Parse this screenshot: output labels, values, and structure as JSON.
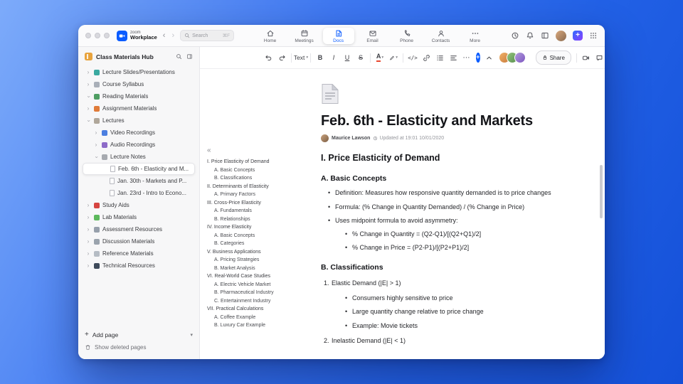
{
  "glyphs": {
    "back": "‹",
    "forward": "›",
    "chevron_down": "▾",
    "more": "⋯",
    "collapse": "«",
    "plus": "+"
  },
  "titlebar": {
    "logo": {
      "top": "zoom",
      "bottom": "Workplace"
    },
    "search": {
      "placeholder": "Search",
      "shortcut": "⌘F"
    },
    "tabs": [
      {
        "label": "Home",
        "active": false
      },
      {
        "label": "Meetings",
        "active": false
      },
      {
        "label": "Docs",
        "active": true
      },
      {
        "label": "Email",
        "active": false
      },
      {
        "label": "Phone",
        "active": false
      },
      {
        "label": "Contacts",
        "active": false
      },
      {
        "label": "More",
        "active": false
      }
    ]
  },
  "sidebar": {
    "title": "Class Materials Hub",
    "items": [
      {
        "label": "Lecture Slides/Presentations",
        "chevron": "right",
        "color": "#3aa9a0",
        "indent": 0
      },
      {
        "label": "Course Syllabus",
        "chevron": "right",
        "color": "#a9afb8",
        "indent": 0
      },
      {
        "label": "Reading Materials",
        "chevron": "down",
        "color": "#4f9e63",
        "indent": 0
      },
      {
        "label": "Assignment Materials",
        "chevron": "right",
        "color": "#e07b39",
        "indent": 0
      },
      {
        "label": "Lectures",
        "chevron": "down",
        "color": "#b0a79a",
        "indent": 0
      },
      {
        "label": "Video Recordings",
        "chevron": "right",
        "color": "#4c7fe0",
        "indent": 1
      },
      {
        "label": "Audio Recordings",
        "chevron": "right",
        "color": "#8d6bc8",
        "indent": 1
      },
      {
        "label": "Lecture Notes",
        "chevron": "down",
        "color": "#a7aab0",
        "indent": 1
      },
      {
        "label": "Feb. 6th - Elasticity and M...",
        "page": true,
        "indent": 2,
        "selected": true
      },
      {
        "label": "Jan. 30th - Markets and P...",
        "page": true,
        "indent": 2
      },
      {
        "label": "Jan. 23rd - Intro to Econo...",
        "page": true,
        "indent": 2
      },
      {
        "label": "Study Aids",
        "chevron": "right",
        "color": "#d64541",
        "indent": 0
      },
      {
        "label": "Lab Materials",
        "chevron": "right",
        "color": "#5cb85c",
        "indent": 0
      },
      {
        "label": "Assessment Resources",
        "chevron": "right",
        "color": "#97a0ac",
        "indent": 0
      },
      {
        "label": "Discussion Materials",
        "chevron": "right",
        "color": "#9aa3ad",
        "indent": 0
      },
      {
        "label": "Reference Materials",
        "chevron": "right",
        "color": "#b5bcc4",
        "indent": 0
      },
      {
        "label": "Technical Resources",
        "chevron": "right",
        "color": "#3e4a5a",
        "indent": 0
      }
    ],
    "add_page": "Add page",
    "show_deleted": "Show deleted pages"
  },
  "toolbar": {
    "text_style": "Text",
    "bold": "B",
    "italic": "I",
    "underline": "U",
    "strikethrough": "S",
    "text_color": "A",
    "code": "</>",
    "share": "Share",
    "accent_color": "#0b5cff"
  },
  "document": {
    "title": "Feb. 6th - Elasticity and Markets",
    "author": "Maurice Lawson",
    "updated": "Updated at 19:01 10/01/2020",
    "outline": [
      {
        "text": "I. Price Elasticity of Demand",
        "level": 1
      },
      {
        "text": "A. Basic Concepts",
        "level": 2
      },
      {
        "text": "B. Classifications",
        "level": 2
      },
      {
        "text": "II. Determinants of Elasticity",
        "level": 1
      },
      {
        "text": "A. Primary Factors",
        "level": 2
      },
      {
        "text": "III. Cross-Price Elasticity",
        "level": 1
      },
      {
        "text": "A. Fundamentals",
        "level": 2
      },
      {
        "text": "B. Relationships",
        "level": 2
      },
      {
        "text": "IV. Income Elasticity",
        "level": 1
      },
      {
        "text": "A. Basic Concepts",
        "level": 2
      },
      {
        "text": "B. Categories",
        "level": 2
      },
      {
        "text": "V. Business Applications",
        "level": 1
      },
      {
        "text": "A. Pricing Strategies",
        "level": 2
      },
      {
        "text": "B. Market Analysis",
        "level": 2
      },
      {
        "text": "VI. Real-World Case Studies",
        "level": 1
      },
      {
        "text": "A. Electric Vehicle Market",
        "level": 2
      },
      {
        "text": "B. Pharmaceutical Industry",
        "level": 2
      },
      {
        "text": "C. Entertainment Industry",
        "level": 2
      },
      {
        "text": "VII. Practical Calculations",
        "level": 1
      },
      {
        "text": "A. Coffee Example",
        "level": 2
      },
      {
        "text": "B. Luxury Car Example",
        "level": 2
      }
    ],
    "blocks": [
      {
        "type": "h1",
        "marker": "",
        "text": "I. Price Elasticity of Demand"
      },
      {
        "type": "h2",
        "marker": "",
        "text": "A. Basic Concepts"
      },
      {
        "type": "b1",
        "marker": "•",
        "text": "Definition: Measures how responsive quantity demanded is to price changes"
      },
      {
        "type": "b1",
        "marker": "•",
        "text": "Formula: (% Change in Quantity Demanded) / (% Change in Price)"
      },
      {
        "type": "b1",
        "marker": "•",
        "text": "Uses midpoint formula to avoid asymmetry:"
      },
      {
        "type": "b2",
        "marker": "•",
        "text": "% Change in Quantity = (Q2-Q1)/[(Q2+Q1)/2]"
      },
      {
        "type": "b2",
        "marker": "•",
        "text": "% Change in Price = (P2-P1)/[(P2+P1)/2]"
      },
      {
        "type": "h2",
        "marker": "",
        "text": "B. Classifications"
      },
      {
        "type": "n1",
        "marker": "1.",
        "text": "Elastic Demand (|E| > 1)"
      },
      {
        "type": "b2",
        "marker": "•",
        "text": "Consumers highly sensitive to price"
      },
      {
        "type": "b2",
        "marker": "•",
        "text": "Large quantity change relative to price change"
      },
      {
        "type": "b2",
        "marker": "•",
        "text": "Example: Movie tickets"
      },
      {
        "type": "n1",
        "marker": "2.",
        "text": "Inelastic Demand (|E| < 1)"
      }
    ]
  }
}
